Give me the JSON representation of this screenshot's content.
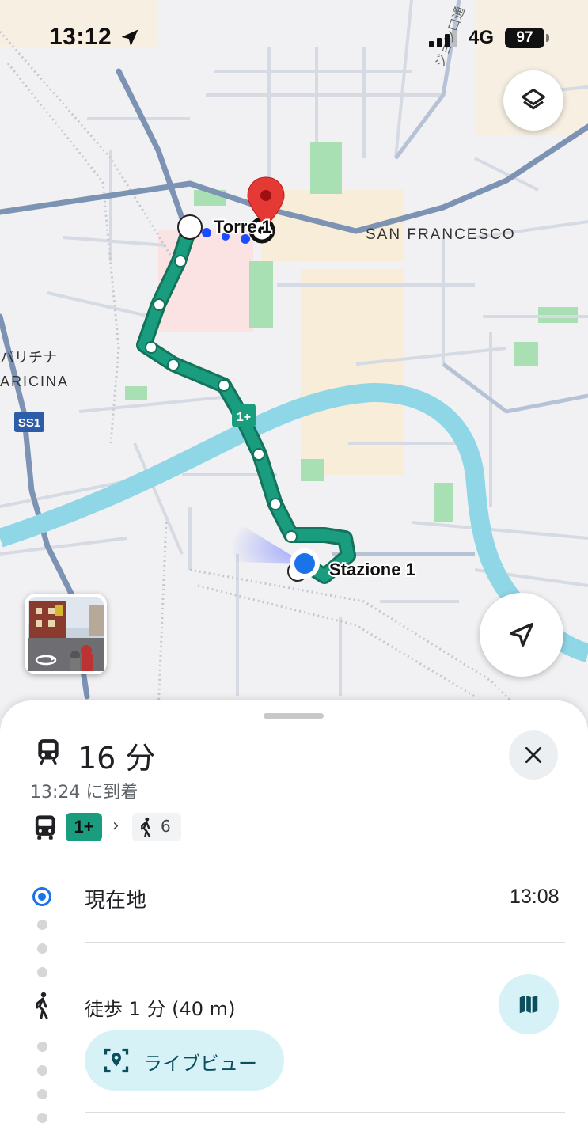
{
  "status_bar": {
    "time": "13:12",
    "network": "4G",
    "battery": "97"
  },
  "map": {
    "labels": {
      "origin_stop": "Torre 1",
      "destination_stop": "Stazione 1",
      "district": "SAN FRANCESCO",
      "area_jp": "バリチナ",
      "area_it": "ARICINA",
      "road_shield": "SS1",
      "route_badge": "1+",
      "street_partial": "ジョン口通"
    },
    "colors": {
      "route": "#1a9c7e",
      "river": "#8fd6e6",
      "road": "#7d93b4",
      "park": "#a8e0b4",
      "destination_pin": "#e53935",
      "user_location": "#1a73e8"
    }
  },
  "controls": {
    "layers_icon": "layers-icon",
    "navigate_icon": "navigation-arrow-icon",
    "street_view_icon": "street-view-rotate-icon"
  },
  "sheet": {
    "duration": "16 分",
    "arrival": "13:24 に到着",
    "route_summary": {
      "line": "1+",
      "walk_minutes": "6"
    },
    "steps": [
      {
        "label": "現在地",
        "time": "13:08"
      },
      {
        "label": "徒歩 1 分 (40 m)"
      }
    ],
    "live_view_label": "ライブビュー"
  }
}
